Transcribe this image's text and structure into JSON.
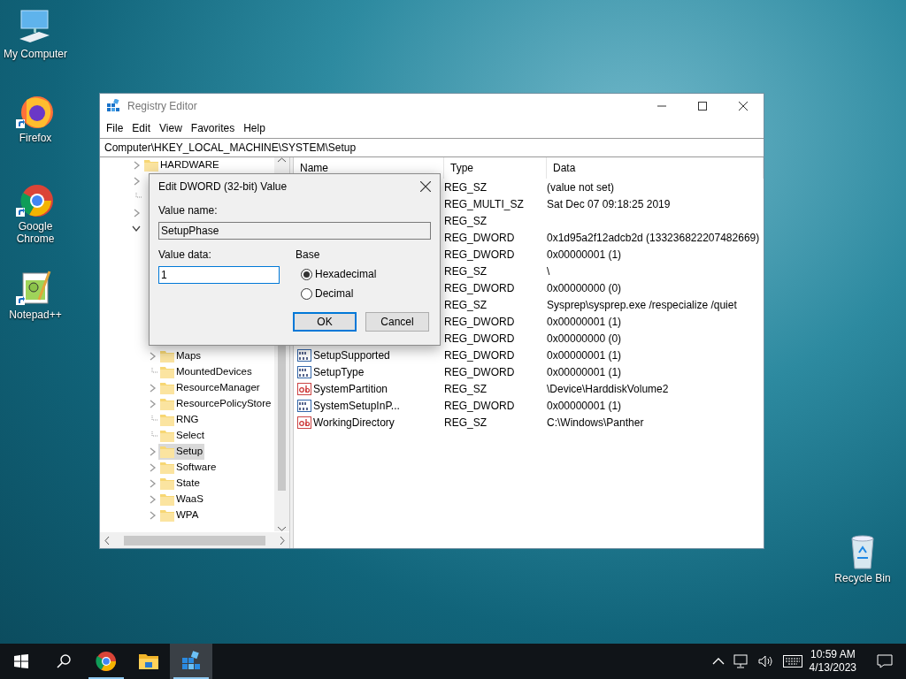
{
  "desktop_icons": [
    {
      "label": "My Computer",
      "kind": "computer"
    },
    {
      "label": "Firefox",
      "kind": "firefox"
    },
    {
      "label": "Google Chrome",
      "kind": "chrome"
    },
    {
      "label": "Notepad++",
      "kind": "notepad"
    },
    {
      "label": "Recycle Bin",
      "kind": "recycle"
    }
  ],
  "window": {
    "title": "Registry Editor",
    "menu": [
      "File",
      "Edit",
      "View",
      "Favorites",
      "Help"
    ],
    "address": "Computer\\HKEY_LOCAL_MACHINE\\SYSTEM\\Setup",
    "tree": {
      "nodes": [
        {
          "label": "HARDWARE",
          "expandable": true,
          "expanded": false,
          "selected": false
        },
        {
          "expandable": true,
          "expanded": false
        },
        {
          "expandable": false
        },
        {
          "expandable": true,
          "expanded": false
        },
        {
          "expandable": true,
          "expanded": true,
          "children": [
            {
              "label": "Maps",
              "expandable": true,
              "expanded": false,
              "selected": false
            },
            {
              "label": "MountedDevices",
              "expandable": false,
              "selected": false
            },
            {
              "label": "ResourceManager",
              "expandable": true,
              "expanded": false,
              "selected": false
            },
            {
              "label": "ResourcePolicyStore",
              "expandable": true,
              "expanded": false,
              "selected": false
            },
            {
              "label": "RNG",
              "expandable": false,
              "selected": false
            },
            {
              "label": "Select",
              "expandable": false,
              "selected": false
            },
            {
              "label": "Setup",
              "expandable": true,
              "expanded": false,
              "selected": true
            },
            {
              "label": "Software",
              "expandable": true,
              "expanded": false,
              "selected": false
            },
            {
              "label": "State",
              "expandable": true,
              "expanded": false,
              "selected": false
            },
            {
              "label": "WaaS",
              "expandable": true,
              "expanded": false,
              "selected": false
            },
            {
              "label": "WPA",
              "expandable": true,
              "expanded": false,
              "selected": false
            }
          ]
        }
      ]
    },
    "list": {
      "columns": [
        "Name",
        "Type",
        "Data"
      ],
      "rows": [
        {
          "type": "REG_SZ",
          "data": "(value not set)"
        },
        {
          "type": "REG_MULTI_SZ",
          "data": "Sat Dec 07 09:18:25 2019"
        },
        {
          "type": "REG_SZ"
        },
        {
          "type": "REG_DWORD",
          "data": "0x1d95a2f12adcb2d (133236822207482669)"
        },
        {
          "type": "REG_DWORD",
          "data": "0x00000001 (1)"
        },
        {
          "type": "REG_SZ",
          "data": "\\"
        },
        {
          "type": "REG_DWORD",
          "data": "0x00000000 (0)"
        },
        {
          "type": "REG_SZ",
          "data": "Sysprep\\sysprep.exe /respecialize /quiet"
        },
        {
          "type": "REG_DWORD",
          "data": "0x00000001 (1)"
        },
        {
          "type": "REG_DWORD",
          "data": "0x00000000 (0)"
        },
        {
          "kind": "binary",
          "name": "SetupSupported",
          "type": "REG_DWORD",
          "data": "0x00000001 (1)"
        },
        {
          "kind": "binary",
          "name": "SetupType",
          "type": "REG_DWORD",
          "data": "0x00000001 (1)"
        },
        {
          "kind": "string",
          "name": "SystemPartition",
          "type": "REG_SZ",
          "data": "\\Device\\HarddiskVolume2"
        },
        {
          "kind": "binary",
          "name": "SystemSetupInP...",
          "type": "REG_DWORD",
          "data": "0x00000001 (1)"
        },
        {
          "kind": "string",
          "name": "WorkingDirectory",
          "type": "REG_SZ",
          "data": "C:\\Windows\\Panther"
        }
      ]
    }
  },
  "dialog": {
    "title": "Edit DWORD (32-bit) Value",
    "value_name_label": "Value name:",
    "value_name": "SetupPhase",
    "value_data_label": "Value data:",
    "value_data": "1",
    "base_label": "Base",
    "base_options": [
      {
        "label": "Hexadecimal",
        "selected": true
      },
      {
        "label": "Decimal",
        "selected": false
      }
    ],
    "buttons": [
      {
        "label": "OK",
        "default": true
      },
      {
        "label": "Cancel",
        "default": false
      }
    ]
  },
  "taskbar": {
    "apps": [
      {
        "kind": "chrome",
        "running": true,
        "active": false
      },
      {
        "kind": "explorer",
        "running": false,
        "active": false
      },
      {
        "kind": "regedit",
        "running": true,
        "active": true
      }
    ],
    "time": "10:59 AM",
    "date": "4/13/2023"
  }
}
